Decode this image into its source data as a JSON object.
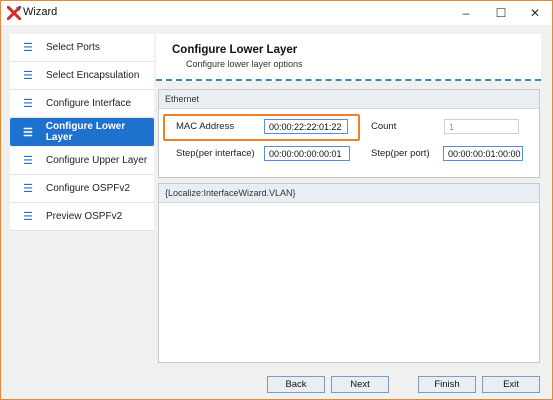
{
  "window": {
    "title": "Wizard",
    "app_icon": "x-logo-icon",
    "brand_color": "#d62b2b",
    "minimize": "–",
    "maximize": "☐",
    "close": "✕"
  },
  "sidebar": {
    "items": [
      {
        "icon": "list-icon",
        "glyph": "☰",
        "label": "Select Ports",
        "active": false
      },
      {
        "icon": "list-icon",
        "glyph": "☰",
        "label": "Select Encapsulation",
        "active": false
      },
      {
        "icon": "list-icon",
        "glyph": "☰",
        "label": "Configure Interface",
        "active": false
      },
      {
        "icon": "list-icon",
        "glyph": "☰",
        "label": "Configure Lower Layer",
        "active": true
      },
      {
        "icon": "list-icon",
        "glyph": "☰",
        "label": "Configure Upper Layer",
        "active": false
      },
      {
        "icon": "list-icon",
        "glyph": "☰",
        "label": "Configure OSPFv2",
        "active": false
      },
      {
        "icon": "list-icon",
        "glyph": "☰",
        "label": "Preview OSPFv2",
        "active": false
      }
    ],
    "active_color": "#1e71cc"
  },
  "header": {
    "title": "Configure Lower Layer",
    "subtitle": "Configure lower layer options"
  },
  "ethernet": {
    "title": "Ethernet",
    "mac_label": "MAC Address",
    "mac_value": "00:00:22:22:01:22",
    "count_label": "Count",
    "count_value": "1",
    "step_if_label": "Step(per interface)",
    "step_if_value": "00:00:00:00:00:01",
    "step_port_label": "Step(per port)",
    "step_port_value": "00:00:00:01:00:00"
  },
  "vlan": {
    "title": "{Localize:InterfaceWizard.VLAN}"
  },
  "footer": {
    "back": "Back",
    "next": "Next",
    "finish": "Finish",
    "exit": "Exit"
  }
}
